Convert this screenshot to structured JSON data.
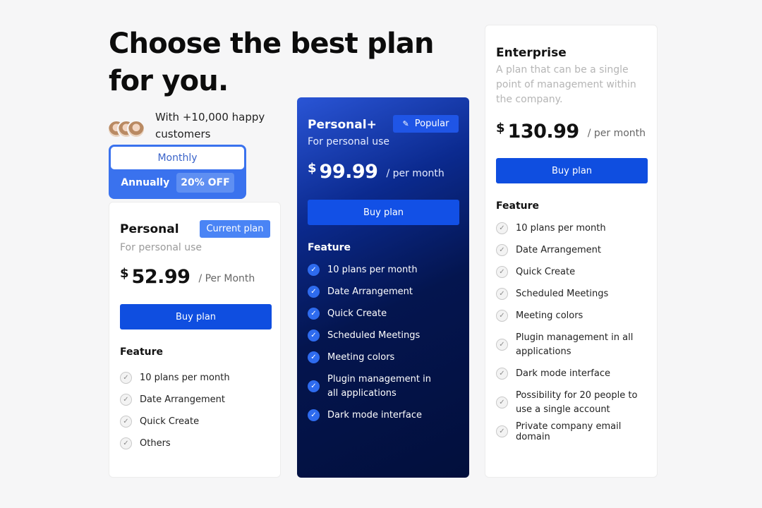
{
  "heading": "Choose the best plan for you.",
  "customers_text": "With +10,000 happy customers",
  "billing_toggle": {
    "monthly_label": "Monthly",
    "annually_label": "Annually",
    "discount_badge": "20% OFF"
  },
  "plans": {
    "personal": {
      "name": "Personal",
      "subtitle": "For personal use",
      "badge": "Current plan",
      "currency": "$",
      "price": "52.99",
      "period": "/ Per Month",
      "buy_label": "Buy plan",
      "feature_title": "Feature",
      "features": [
        "10 plans per month",
        "Date Arrangement",
        "Quick Create",
        "Others"
      ]
    },
    "personal_plus": {
      "name": "Personal+",
      "subtitle": "For personal use",
      "badge": "Popular",
      "currency": "$",
      "price": "99.99",
      "period": "/ per month",
      "buy_label": "Buy plan",
      "feature_title": "Feature",
      "features": [
        "10 plans per month",
        "Date Arrangement",
        "Quick Create",
        "Scheduled Meetings",
        "Meeting colors",
        "Plugin management in all applications",
        "Dark mode interface"
      ]
    },
    "enterprise": {
      "name": "Enterprise",
      "subtitle": "A plan that can be a single point of management within the company.",
      "currency": "$",
      "price": "130.99",
      "period": "/ per month",
      "buy_label": "Buy plan",
      "feature_title": "Feature",
      "features": [
        "10 plans per month",
        "Date Arrangement",
        "Quick Create",
        "Scheduled Meetings",
        "Meeting colors",
        "Plugin management in all applications",
        "Dark mode interface",
        "Possibility for 20 people to use a single account",
        "Private company email domain"
      ]
    }
  },
  "colors": {
    "accent": "#0f4ee0",
    "toggle": "#3a72ee",
    "dark_card": "#04154f"
  }
}
